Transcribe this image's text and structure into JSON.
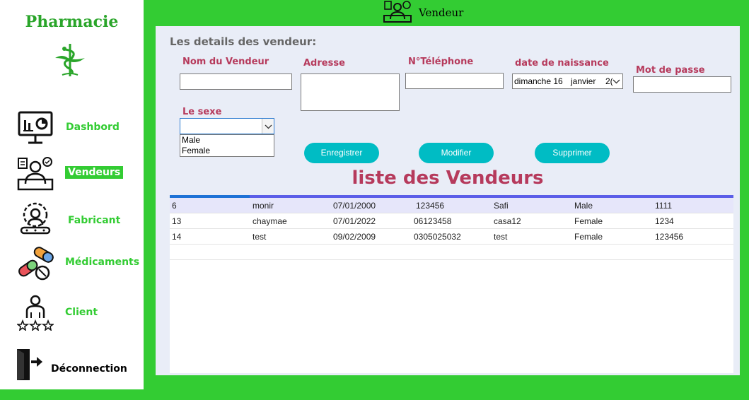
{
  "window": {
    "title": "Vendeur",
    "accent": "#33cc33",
    "label_color": "#b63a5c",
    "button_color": "#00bcc4"
  },
  "sidebar": {
    "brand": "Pharmacie",
    "logo_icon": "caduceus-icon",
    "items": [
      {
        "label": "Dashbord",
        "icon": "dashboard-icon",
        "active": false
      },
      {
        "label": "Vendeurs",
        "icon": "vendors-icon",
        "active": true
      },
      {
        "label": "Fabricant",
        "icon": "manufacturer-icon",
        "active": false
      },
      {
        "label": "Médicaments",
        "icon": "pills-icon",
        "active": false
      },
      {
        "label": "Client",
        "icon": "client-icon",
        "active": false
      },
      {
        "label": "Déconnection",
        "icon": "logout-icon",
        "active": false
      }
    ]
  },
  "form": {
    "title": "Les details des vendeur:",
    "nom_label": "Nom du Vendeur",
    "nom_value": "",
    "adresse_label": "Adresse",
    "adresse_value": "",
    "tel_label": "N°Téléphone",
    "tel_value": "",
    "naissance_label": "date de naissance",
    "naissance_day": "dimanche 16",
    "naissance_month": "janvier",
    "naissance_year_fragment": "2(",
    "mdp_label": "Mot de passe",
    "mdp_value": "",
    "sexe_label": "Le sexe",
    "sexe_value": "",
    "sexe_options": [
      "Male",
      "Female"
    ]
  },
  "buttons": {
    "save": "Enregistrer",
    "edit": "Modifier",
    "delete": "Supprimer"
  },
  "list": {
    "title": "liste des Vendeurs",
    "rows": [
      [
        "6",
        "monir",
        "07/01/2000",
        "123456",
        "Safi",
        "Male",
        "1111"
      ],
      [
        "13",
        "chaymae",
        "07/01/2022",
        "06123458",
        "casa12",
        "Female",
        "1234"
      ],
      [
        "14",
        "test",
        "09/02/2009",
        "0305025032",
        "test",
        "Female",
        "123456"
      ]
    ]
  }
}
